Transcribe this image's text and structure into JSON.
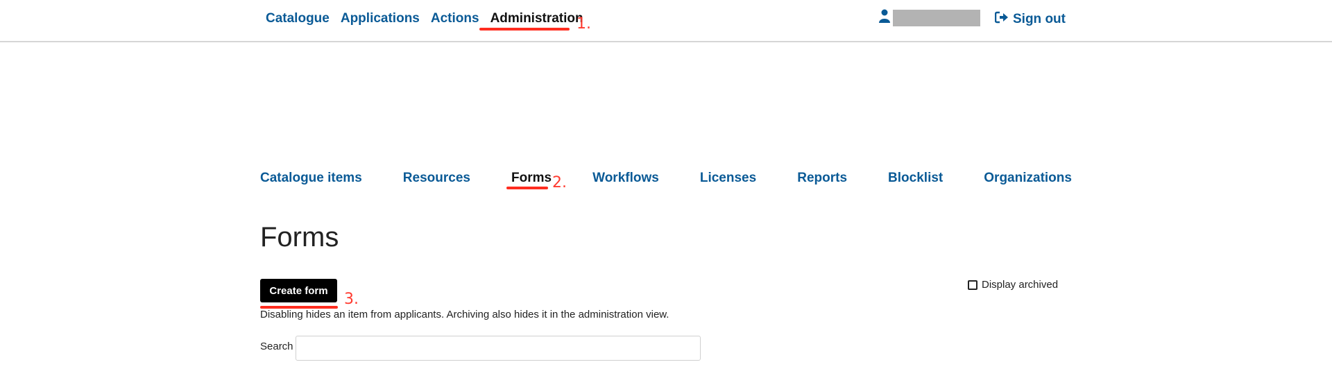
{
  "header": {
    "nav": [
      {
        "label": "Catalogue"
      },
      {
        "label": "Applications"
      },
      {
        "label": "Actions"
      },
      {
        "label": "Administration"
      }
    ],
    "sign_out": "Sign out"
  },
  "annotations": {
    "step1": "1.",
    "step2": "2.",
    "step3": "3.",
    "color": "#ff2d20"
  },
  "admin_tabs": [
    {
      "label": "Catalogue items"
    },
    {
      "label": "Resources"
    },
    {
      "label": "Forms"
    },
    {
      "label": "Workflows"
    },
    {
      "label": "Licenses"
    },
    {
      "label": "Reports"
    },
    {
      "label": "Blocklist"
    },
    {
      "label": "Organizations"
    }
  ],
  "page": {
    "title": "Forms",
    "create_button": "Create form",
    "display_archived": "Display archived",
    "help_text": "Disabling hides an item from applicants. Archiving also hides it in the administration view.",
    "search_label": "Search",
    "search_value": ""
  },
  "colors": {
    "link": "#0a5a96",
    "active": "#111111",
    "button": "#000000"
  }
}
